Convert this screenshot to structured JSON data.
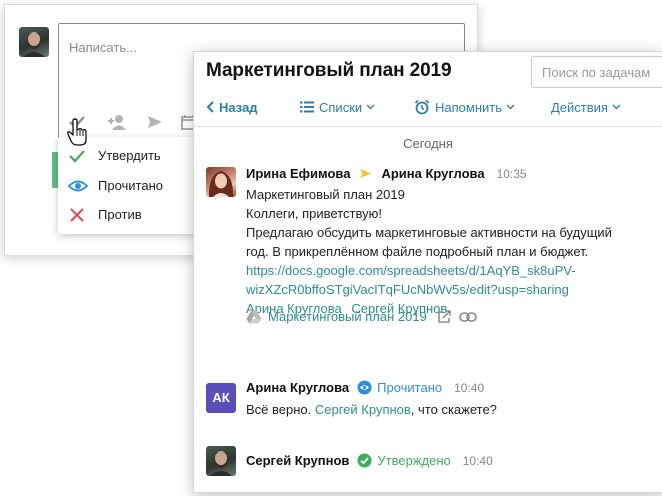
{
  "compose": {
    "placeholder": "Написать...",
    "tools": [
      "checkmark-icon",
      "add-user-icon",
      "send-icon",
      "calendar-icon"
    ]
  },
  "approval_menu": {
    "items": [
      {
        "label": "Утвердить",
        "icon": "checkmark-icon",
        "color": "#3fae5c"
      },
      {
        "label": "Прочитано",
        "icon": "eye-icon",
        "color": "#2f8fd6"
      },
      {
        "label": "Против",
        "icon": "cross-icon",
        "color": "#e2474f"
      }
    ]
  },
  "task": {
    "title": "Маркетинговый план 2019",
    "search_placeholder": "Поиск по задачам",
    "toolbar": {
      "back": "Назад",
      "lists": "Списки",
      "remind": "Напомнить",
      "actions": "Действия"
    },
    "day_separator": "Сегодня",
    "messages": [
      {
        "author": "Ирина Ефимова",
        "recipient": "Арина Круглова",
        "time": "10:35",
        "lines": [
          "Маркетинговый план 2019",
          "Коллеги, приветствую!",
          "Предлагаю обсудить маркетинговые активности на будущий",
          "год. В прикреплённом файле подробный план и бюджет."
        ],
        "link_lines": [
          "https://docs.google.com/spreadsheets/d/1AqYB_sk8uPV-",
          "wizXZcR0bffoSTgiVacITqFUcNbWv5s/edit?usp=sharing"
        ],
        "mentions": [
          "Арина Круглова",
          "Сергей Крупнов"
        ],
        "attachment": "Маркетинговый план 2019"
      },
      {
        "author": "Арина Круглова",
        "avatar_initials": "АК",
        "status": "Прочитано",
        "time": "10:40",
        "text_before": "Всё верно. ",
        "mention": "Сергей Крупнов",
        "text_after": ", что скажете?"
      },
      {
        "author": "Сергей Крупнов",
        "status": "Утверждено",
        "time": "10:40"
      }
    ]
  },
  "colors": {
    "link": "#2e8f8c",
    "toolbar": "#2a7fa8",
    "approved": "#3fae5c",
    "read": "#2f8fd6",
    "against": "#e2474f",
    "avatar_ak": "#5a4fb8"
  }
}
